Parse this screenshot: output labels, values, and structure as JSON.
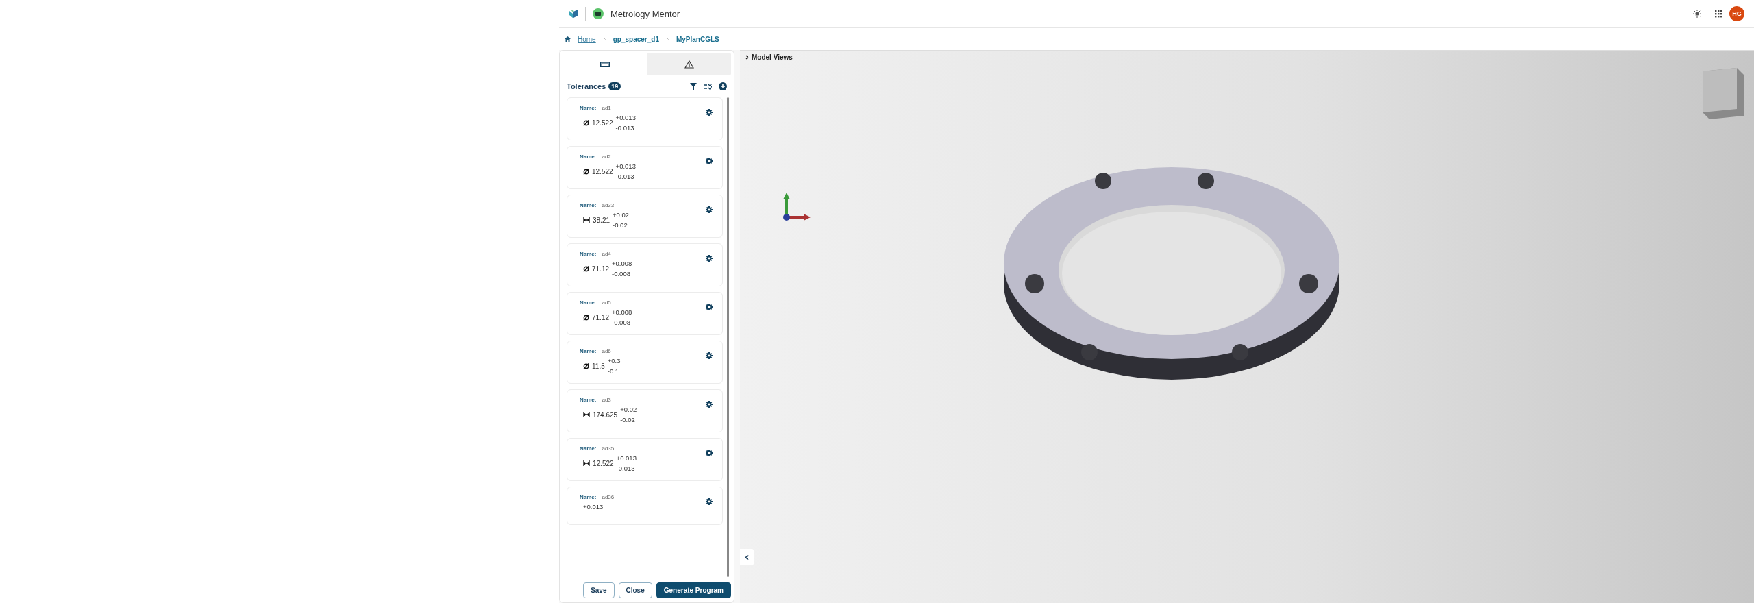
{
  "header": {
    "app_name": "Metrology Mentor",
    "avatar_initials": "HG"
  },
  "breadcrumb": [
    {
      "label": "Home",
      "kind": "home"
    },
    {
      "label": "gp_spacer_d1",
      "kind": "crumb"
    },
    {
      "label": "MyPlanCGLS",
      "kind": "crumb"
    }
  ],
  "panel": {
    "tabs": [
      {
        "kind": "measure",
        "selected": true
      },
      {
        "kind": "alerts",
        "selected": false
      }
    ],
    "title": "Tolerances",
    "count": "19",
    "tolerances": [
      {
        "name_label": "Name:",
        "name": "ad1",
        "kind": "diameter",
        "value": "12.522",
        "upper": "+0.013",
        "lower": "-0.013"
      },
      {
        "name_label": "Name:",
        "name": "ad2",
        "kind": "diameter",
        "value": "12.522",
        "upper": "+0.013",
        "lower": "-0.013"
      },
      {
        "name_label": "Name:",
        "name": "ad33",
        "kind": "length",
        "value": "38.21",
        "upper": "+0.02",
        "lower": "-0.02"
      },
      {
        "name_label": "Name:",
        "name": "ad4",
        "kind": "diameter",
        "value": "71.12",
        "upper": "+0.008",
        "lower": "-0.008"
      },
      {
        "name_label": "Name:",
        "name": "ad5",
        "kind": "diameter",
        "value": "71.12",
        "upper": "+0.008",
        "lower": "-0.008"
      },
      {
        "name_label": "Name:",
        "name": "ad6",
        "kind": "diameter",
        "value": "11.5",
        "upper": "+0.3",
        "lower": "-0.1"
      },
      {
        "name_label": "Name:",
        "name": "ad3",
        "kind": "length",
        "value": "174.625",
        "upper": "+0.02",
        "lower": "-0.02"
      },
      {
        "name_label": "Name:",
        "name": "ad35",
        "kind": "length",
        "value": "12.522",
        "upper": "+0.013",
        "lower": "-0.013"
      },
      {
        "name_label": "Name:",
        "name": "ad36",
        "upper": "+0.013"
      }
    ],
    "buttons": [
      {
        "label": "Save",
        "kind": "secondary"
      },
      {
        "label": "Close",
        "kind": "secondary"
      },
      {
        "label": "Generate Program",
        "kind": "primary"
      }
    ]
  },
  "viewport": {
    "title": "Model Views"
  }
}
